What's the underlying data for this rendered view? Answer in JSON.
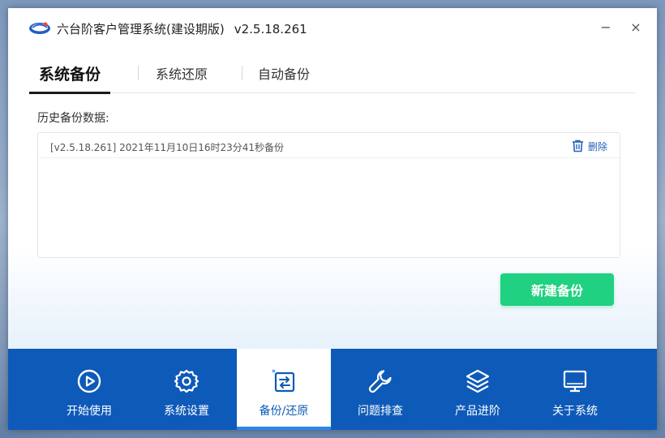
{
  "window": {
    "title": "六台阶客户管理系统(建设期版)",
    "version": "v2.5.18.261",
    "minimize_glyph": "−",
    "close_glyph": "×"
  },
  "tabs": [
    {
      "label": "系统备份",
      "active": true
    },
    {
      "label": "系统还原",
      "active": false
    },
    {
      "label": "自动备份",
      "active": false
    }
  ],
  "history": {
    "label": "历史备份数据:",
    "items": [
      {
        "text": "[v2.5.18.261] 2021年11月10日16时23分41秒备份",
        "delete_label": "删除"
      }
    ]
  },
  "actions": {
    "new_backup_label": "新建备份"
  },
  "nav": [
    {
      "label": "开始使用",
      "icon": "play-circle-icon",
      "active": false
    },
    {
      "label": "系统设置",
      "icon": "gear-icon",
      "active": false
    },
    {
      "label": "备份/还原",
      "icon": "backup-restore-icon",
      "active": true
    },
    {
      "label": "问题排查",
      "icon": "wrench-icon",
      "active": false
    },
    {
      "label": "产品进阶",
      "icon": "layers-icon",
      "active": false
    },
    {
      "label": "关于系统",
      "icon": "monitor-icon",
      "active": false
    }
  ],
  "colors": {
    "accent_green": "#1fd180",
    "nav_blue": "#0e5ab8",
    "link_blue": "#2463b7",
    "active_underline": "#2c86f0"
  }
}
